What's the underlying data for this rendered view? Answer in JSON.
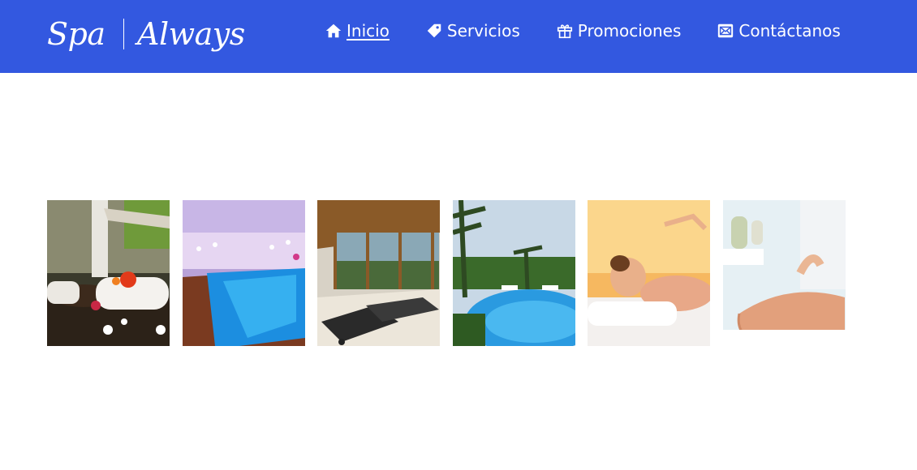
{
  "brand": {
    "left_text": "Spa",
    "right_text": "Always"
  },
  "nav": {
    "items": [
      {
        "label": "Inicio",
        "icon": "home-icon",
        "active": true
      },
      {
        "label": "Servicios",
        "icon": "tag-icon",
        "active": false
      },
      {
        "label": "Promociones",
        "icon": "gift-icon",
        "active": false
      },
      {
        "label": "Contáctanos",
        "icon": "envelope-icon",
        "active": false
      }
    ]
  },
  "gallery": {
    "images": [
      {
        "subject": "towels-and-flowers"
      },
      {
        "subject": "indoor-pool"
      },
      {
        "subject": "lounge-chairs-room"
      },
      {
        "subject": "outdoor-pool-palms"
      },
      {
        "subject": "woman-relaxing-massage"
      },
      {
        "subject": "back-massage"
      }
    ]
  },
  "colors": {
    "header_bg": "#3358e0",
    "header_text": "#ffffff",
    "page_bg": "#ffffff"
  }
}
